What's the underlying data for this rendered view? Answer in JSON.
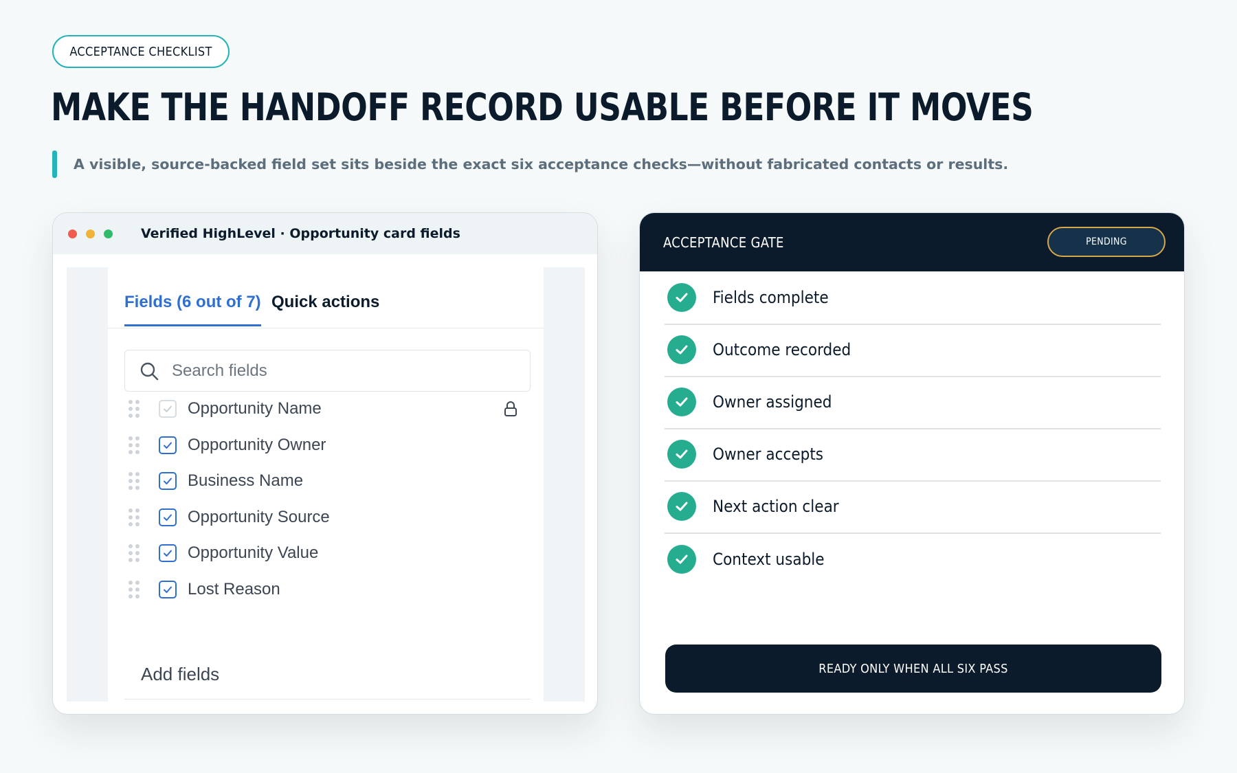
{
  "eyebrow": "ACCEPTANCE CHECKLIST",
  "headline": "MAKE THE HANDOFF RECORD USABLE BEFORE IT MOVES",
  "subline": "A visible, source-backed field set sits beside the exact six acceptance checks—without fabricated contacts or results.",
  "colors": {
    "accent": "#24b3b8",
    "navy": "#0b1b2b",
    "link_blue": "#2f6fd0",
    "check_green": "#26ad8f",
    "pending_border": "#d6a84a"
  },
  "left_card": {
    "window_title": "Verified HighLevel · Opportunity card fields",
    "window_dots": [
      "#f05a4f",
      "#f2b33a",
      "#2fba6c"
    ],
    "tabs": [
      {
        "label": "Fields (6 out of 7)",
        "active": true
      },
      {
        "label": "Quick actions",
        "active": false
      }
    ],
    "search": {
      "placeholder": "Search fields",
      "icon": "search-icon"
    },
    "fields": [
      {
        "label": "Opportunity Name",
        "checked": true,
        "locked": true
      },
      {
        "label": "Opportunity Owner",
        "checked": true,
        "locked": false
      },
      {
        "label": "Business Name",
        "checked": true,
        "locked": false
      },
      {
        "label": "Opportunity Source",
        "checked": true,
        "locked": false
      },
      {
        "label": "Opportunity Value",
        "checked": true,
        "locked": false
      },
      {
        "label": "Lost Reason",
        "checked": true,
        "locked": false
      }
    ],
    "add_fields_label": "Add fields"
  },
  "right_card": {
    "title": "ACCEPTANCE GATE",
    "status": "PENDING",
    "checks": [
      {
        "label": "Fields complete",
        "passed": true
      },
      {
        "label": "Outcome recorded",
        "passed": true
      },
      {
        "label": "Owner assigned",
        "passed": true
      },
      {
        "label": "Owner accepts",
        "passed": true
      },
      {
        "label": "Next action clear",
        "passed": true
      },
      {
        "label": "Context usable",
        "passed": true
      }
    ],
    "button_label": "READY ONLY WHEN ALL SIX PASS"
  }
}
